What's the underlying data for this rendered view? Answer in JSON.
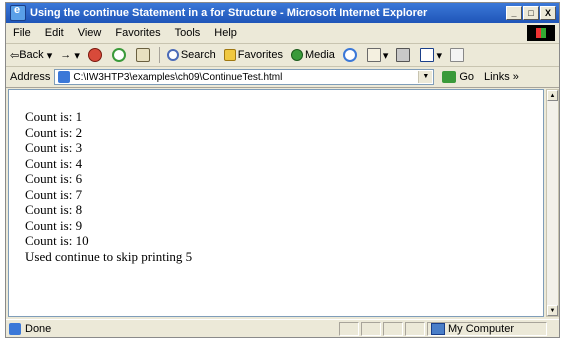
{
  "window": {
    "title": "Using the continue Statement in a for Structure - Microsoft Internet Explorer",
    "minimize": "_",
    "maximize": "□",
    "close": "X"
  },
  "menu": [
    "File",
    "Edit",
    "View",
    "Favorites",
    "Tools",
    "Help"
  ],
  "toolbar": {
    "back": "Back",
    "forward": "→",
    "search": "Search",
    "favorites": "Favorites",
    "media": "Media"
  },
  "address": {
    "label": "Address",
    "url": "C:\\IW3HTP3\\examples\\ch09\\ContinueTest.html",
    "go": "Go",
    "links": "Links »"
  },
  "content": {
    "lines": [
      "Count is: 1",
      "Count is: 2",
      "Count is: 3",
      "Count is: 4",
      "Count is: 6",
      "Count is: 7",
      "Count is: 8",
      "Count is: 9",
      "Count is: 10",
      "Used continue to skip printing 5"
    ]
  },
  "status": {
    "text": "Done",
    "zone": "My Computer"
  },
  "colors": {
    "titlebar": "#245edb",
    "chrome": "#ece9d8"
  }
}
